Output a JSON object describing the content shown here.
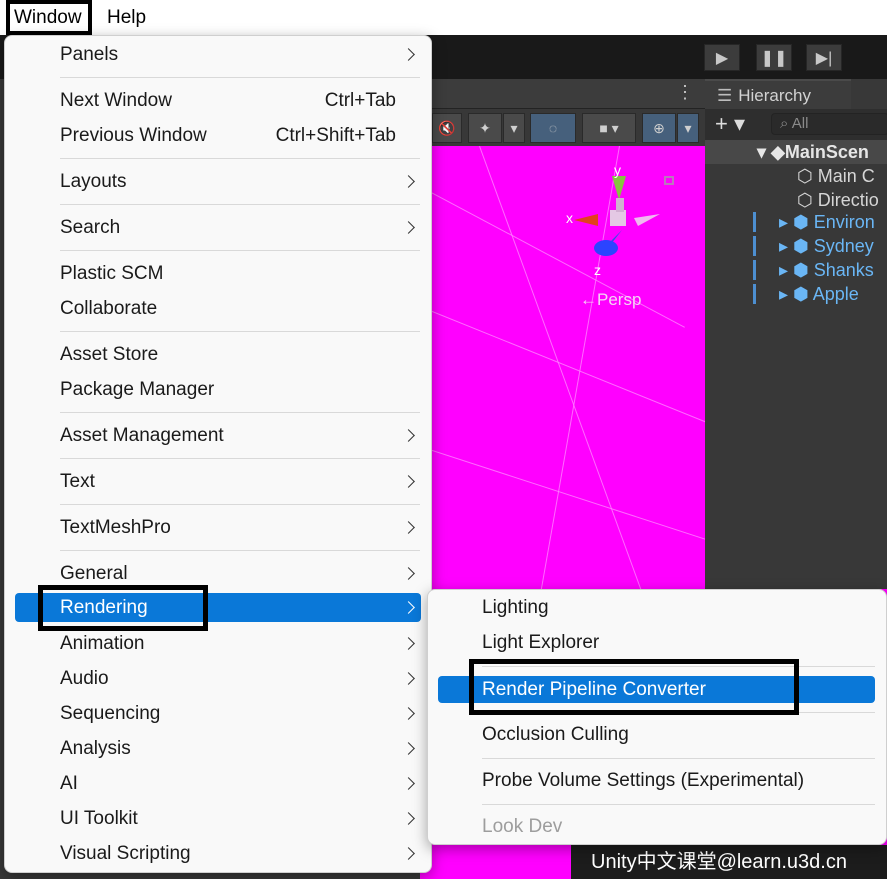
{
  "menubar": {
    "window": "Window",
    "help": "Help"
  },
  "window_menu": {
    "items": [
      {
        "label": "Panels",
        "shortcut": "",
        "submenu": true
      },
      {
        "label": "Next Window",
        "shortcut": "Ctrl+Tab",
        "submenu": false
      },
      {
        "label": "Previous Window",
        "shortcut": "Ctrl+Shift+Tab",
        "submenu": false
      },
      {
        "label": "Layouts",
        "shortcut": "",
        "submenu": true
      },
      {
        "label": "Search",
        "shortcut": "",
        "submenu": true
      },
      {
        "label": "Plastic SCM",
        "shortcut": "",
        "submenu": false
      },
      {
        "label": "Collaborate",
        "shortcut": "",
        "submenu": false
      },
      {
        "label": "Asset Store",
        "shortcut": "",
        "submenu": false
      },
      {
        "label": "Package Manager",
        "shortcut": "",
        "submenu": false
      },
      {
        "label": "Asset Management",
        "shortcut": "",
        "submenu": true
      },
      {
        "label": "Text",
        "shortcut": "",
        "submenu": true
      },
      {
        "label": "TextMeshPro",
        "shortcut": "",
        "submenu": true
      },
      {
        "label": "General",
        "shortcut": "",
        "submenu": true
      },
      {
        "label": "Rendering",
        "shortcut": "",
        "submenu": true,
        "highlighted": true
      },
      {
        "label": "Animation",
        "shortcut": "",
        "submenu": true
      },
      {
        "label": "Audio",
        "shortcut": "",
        "submenu": true
      },
      {
        "label": "Sequencing",
        "shortcut": "",
        "submenu": true
      },
      {
        "label": "Analysis",
        "shortcut": "",
        "submenu": true
      },
      {
        "label": "AI",
        "shortcut": "",
        "submenu": true
      },
      {
        "label": "UI Toolkit",
        "shortcut": "",
        "submenu": true
      },
      {
        "label": "Visual Scripting",
        "shortcut": "",
        "submenu": true
      }
    ]
  },
  "rendering_submenu": {
    "items": [
      {
        "label": "Lighting",
        "enabled": true
      },
      {
        "label": "Light Explorer",
        "enabled": true
      },
      {
        "label": "Render Pipeline Converter",
        "enabled": true,
        "highlighted": true
      },
      {
        "label": "Occlusion Culling",
        "enabled": true
      },
      {
        "label": "Probe Volume Settings (Experimental)",
        "enabled": true
      },
      {
        "label": "Look Dev",
        "enabled": false
      }
    ]
  },
  "hierarchy": {
    "tab_label": "Hierarchy",
    "search_placeholder": "All",
    "rows": [
      "MainScen",
      "Main C",
      "Directio",
      "Environ",
      "Sydney",
      "Shanks",
      "Apple"
    ]
  },
  "scene_view": {
    "gizmo_axes": [
      "y",
      "x",
      "z"
    ],
    "projection_label": "←Persp"
  },
  "watermark": "Unity中文课堂@learn.u3d.cn",
  "colors": {
    "highlight": "#0a78d8",
    "scene_background": "#ff00ff",
    "hierarchy_prefab": "#6ab6f5"
  }
}
